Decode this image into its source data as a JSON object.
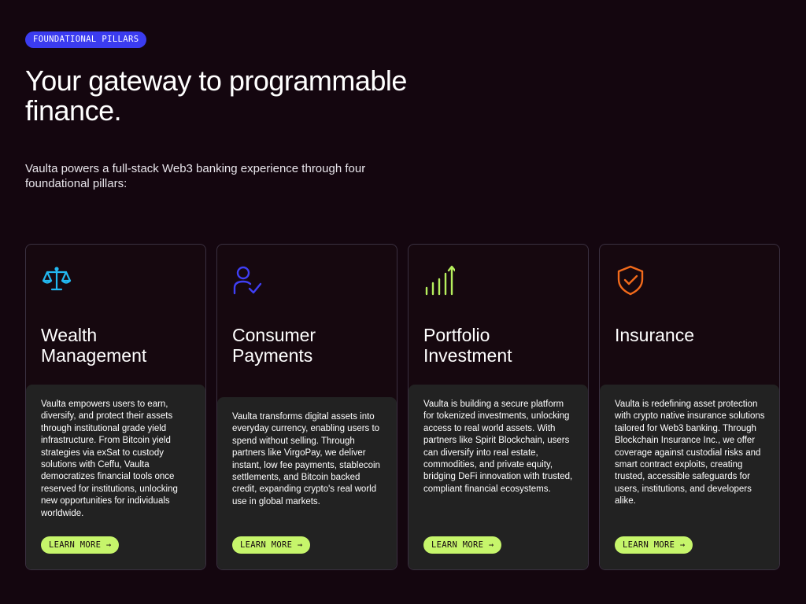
{
  "badge": "FOUNDATIONAL PILLARS",
  "headline": "Your gateway to programmable finance.",
  "intro": "Vaulta powers a full-stack Web3 banking experience through four foundational pillars:",
  "colors": {
    "background": "#14060f",
    "badge": "#3b3cf0",
    "button": "#c6f56b",
    "card_body": "#222222"
  },
  "cards": [
    {
      "icon": "scales-icon",
      "icon_color": "#22b8f0",
      "title": "Wealth Management",
      "description": "Vaulta empowers users to earn, diversify, and protect their assets through institutional grade yield infrastructure. From Bitcoin yield strategies via exSat to custody solutions with Ceffu, Vaulta democratizes financial tools once reserved for institutions, unlocking new opportunities for individuals worldwide.",
      "button": "LEARN MORE →"
    },
    {
      "icon": "user-check-icon",
      "icon_color": "#3f3ff5",
      "title": "Consumer Payments",
      "description": "Vaulta transforms digital assets into everyday currency, enabling users to spend without selling. Through partners like VirgoPay, we deliver instant, low fee payments, stablecoin settlements, and Bitcoin backed credit, expanding crypto's real world use in global markets.",
      "button": "LEARN MORE →"
    },
    {
      "icon": "growth-bars-icon",
      "icon_color": "#b6ef5d",
      "title": "Portfolio Investment",
      "description": "Vaulta is building a secure platform for tokenized investments, unlocking access to real world assets. With partners like Spirit Blockchain, users can diversify into real estate, commodities, and private equity, bridging DeFi innovation with trusted, compliant financial ecosystems.",
      "button": "LEARN MORE →"
    },
    {
      "icon": "shield-check-icon",
      "icon_color": "#f26a1b",
      "title": "Insurance",
      "description": "Vaulta is redefining asset protection with crypto native insurance solutions tailored for Web3 banking. Through Blockchain Insurance Inc., we offer coverage against custodial risks and smart contract exploits, creating trusted, accessible safeguards for users, institutions, and developers alike.",
      "button": "LEARN MORE →"
    }
  ]
}
